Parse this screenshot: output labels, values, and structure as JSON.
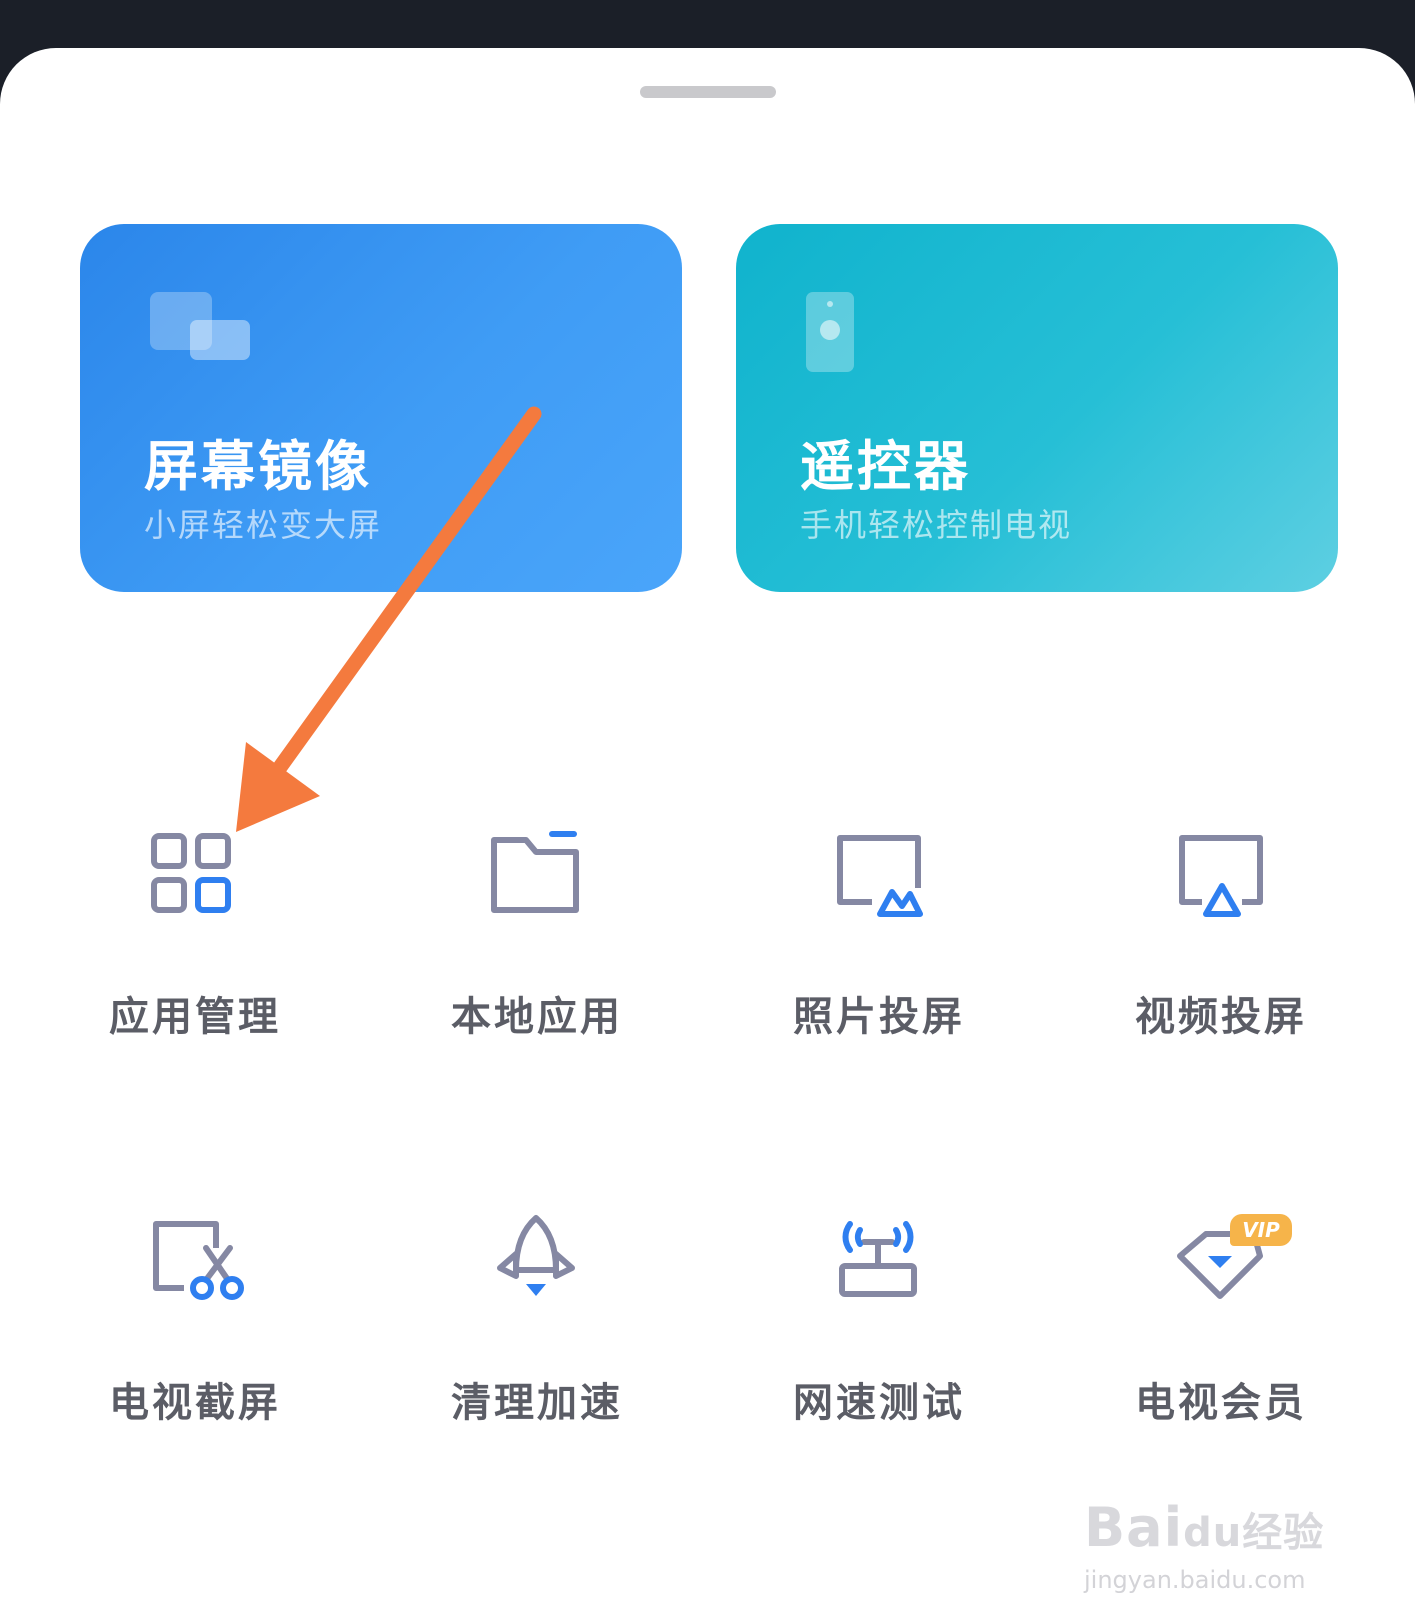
{
  "colors": {
    "accent_blue": "#2b86ea",
    "accent_teal": "#10b3cd",
    "icon_gray": "#8588a3",
    "icon_blue": "#2f7ff0",
    "label_gray": "#5b5d66",
    "annotation_arrow": "#f47a3e",
    "vip_badge": "#f6b44a"
  },
  "cards": [
    {
      "title": "屏幕镜像",
      "subtitle": "小屏轻松变大屏",
      "icon": "screen-mirror-icon"
    },
    {
      "title": "遥控器",
      "subtitle": "手机轻松控制电视",
      "icon": "remote-control-icon"
    }
  ],
  "grid": [
    {
      "label": "应用管理",
      "icon": "app-grid-icon"
    },
    {
      "label": "本地应用",
      "icon": "folder-icon"
    },
    {
      "label": "照片投屏",
      "icon": "photo-cast-icon"
    },
    {
      "label": "视频投屏",
      "icon": "video-cast-icon"
    },
    {
      "label": "电视截屏",
      "icon": "screenshot-scissors-icon"
    },
    {
      "label": "清理加速",
      "icon": "rocket-icon"
    },
    {
      "label": "网速测试",
      "icon": "router-signal-icon"
    },
    {
      "label": "电视会员",
      "icon": "vip-diamond-icon"
    }
  ],
  "vip_badge_text": "VIP",
  "watermark": {
    "brand": "Bai",
    "brand_suffix": "du",
    "cn": "经验",
    "url": "jingyan.baidu.com"
  }
}
